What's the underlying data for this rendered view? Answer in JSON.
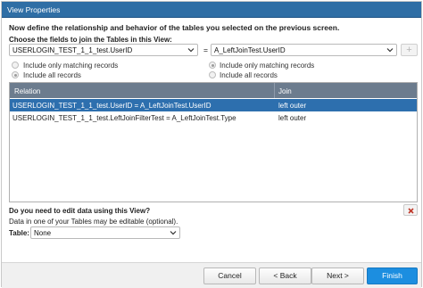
{
  "window": {
    "title": "View Properties"
  },
  "instructions": "Now define the relationship and behavior of the tables you selected on the previous screen.",
  "fields_label": "Choose the fields to join the Tables in this View:",
  "join": {
    "left_field": "USERLOGIN_TEST_1_1_test.UserID",
    "operator": "=",
    "right_field": "A_LeftJoinTest.UserID",
    "add_button": "+"
  },
  "left_options": {
    "option1": "Include only matching records",
    "option2": "Include all records",
    "selected": 2
  },
  "right_options": {
    "option1": "Include only matching records",
    "option2": "Include all records",
    "selected": 1
  },
  "relations_table": {
    "columns": [
      "Relation",
      "Join"
    ],
    "rows": [
      {
        "relation": "USERLOGIN_TEST_1_1_test.UserID = A_LeftJoinTest.UserID",
        "join": "left outer",
        "selected": true
      },
      {
        "relation": "USERLOGIN_TEST_1_1_test.LeftJoinFilterTest = A_LeftJoinTest.Type",
        "join": "left outer",
        "selected": false
      }
    ]
  },
  "edit_section": {
    "question": "Do you need to edit data using this View?",
    "note": "Data in one of your Tables may be editable (optional).",
    "table_label": "Table:",
    "table_value": "None"
  },
  "buttons": {
    "cancel": "Cancel",
    "back": "< Back",
    "next": "Next >",
    "finish": "Finish"
  },
  "colors": {
    "titlebar": "#2f6ea5",
    "selected_row": "#2d6fae",
    "grid_header": "#6c7c8e",
    "finish_button": "#1c8ee0",
    "delete_icon": "#c0392b"
  }
}
